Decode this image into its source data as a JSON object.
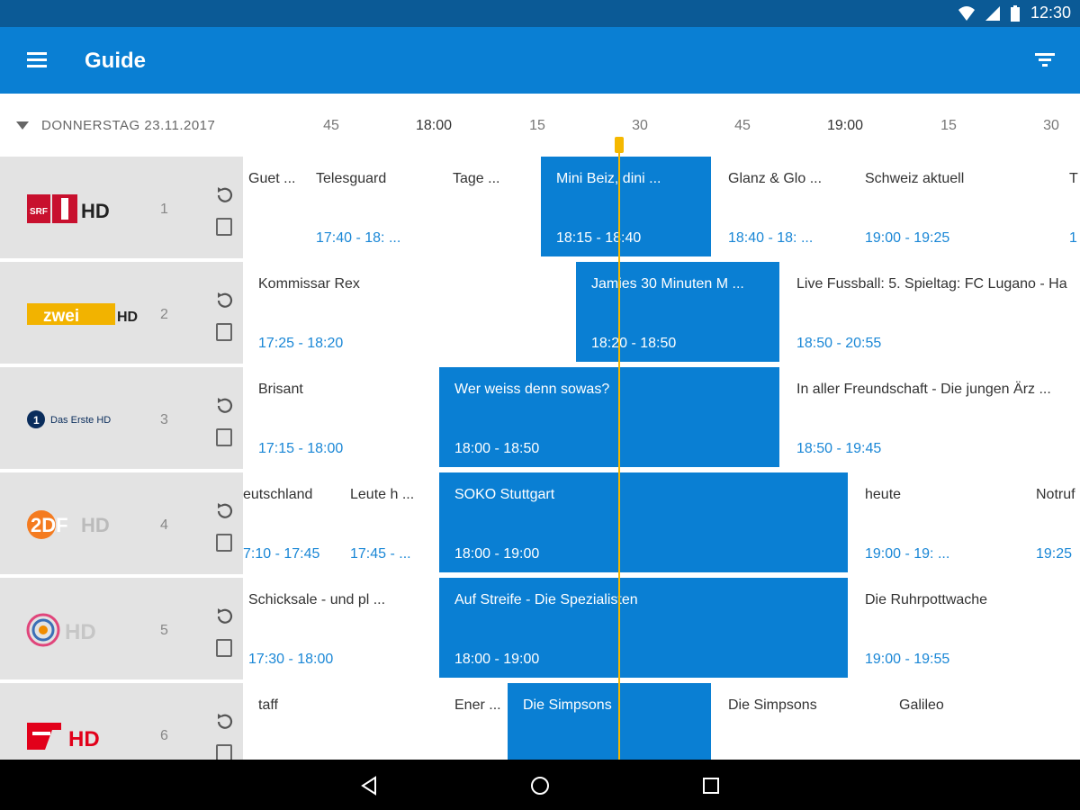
{
  "status": {
    "time": "12:30"
  },
  "appbar": {
    "title": "Guide"
  },
  "timebar": {
    "date": "DONNERSTAG 23.11.2017",
    "ticks": [
      "45",
      "18:00",
      "15",
      "30",
      "45",
      "19:00",
      "15",
      "30"
    ]
  },
  "colors": {
    "accent": "#0a7fd3",
    "now_line": "#f5b800",
    "time_text": "#1a87d6"
  },
  "channels": [
    {
      "number": "1",
      "logo": "SRF 1 HD",
      "programs": [
        {
          "title": "Guet ...",
          "time": ""
        },
        {
          "title": "Telesguard",
          "time": "17:40 - 18: ..."
        },
        {
          "title": "Tage ...",
          "time": ""
        },
        {
          "title": "Mini Beiz, dini ...",
          "time": "18:15 - 18:40"
        },
        {
          "title": "Glanz & Glo ...",
          "time": "18:40 - 18: ..."
        },
        {
          "title": "Schweiz aktuell",
          "time": "19:00 - 19:25"
        },
        {
          "title": "T",
          "time": "1"
        }
      ]
    },
    {
      "number": "2",
      "logo": "SRF zwei HD",
      "programs": [
        {
          "title": "Kommissar Rex",
          "time": "17:25 - 18:20"
        },
        {
          "title": "Jamies 30 Minuten M ...",
          "time": "18:20 - 18:50"
        },
        {
          "title": "Live Fussball: 5. Spieltag: FC Lugano - Ha",
          "time": "18:50 - 20:55"
        }
      ]
    },
    {
      "number": "3",
      "logo": "Das Erste HD",
      "programs": [
        {
          "title": "Brisant",
          "time": "17:15 - 18:00"
        },
        {
          "title": "Wer weiss denn sowas?",
          "time": "18:00 - 18:50"
        },
        {
          "title": "In aller Freundschaft - Die jungen Ärz ...",
          "time": "18:50 - 19:45"
        }
      ]
    },
    {
      "number": "4",
      "logo": "ZDF HD",
      "programs": [
        {
          "title": "eutschland",
          "time": "7:10 - 17:45"
        },
        {
          "title": "Leute h ...",
          "time": "17:45 - ..."
        },
        {
          "title": "SOKO Stuttgart",
          "time": "18:00 - 19:00"
        },
        {
          "title": "heute",
          "time": "19:00 - 19: ..."
        },
        {
          "title": "Notruf",
          "time": "19:25"
        }
      ]
    },
    {
      "number": "5",
      "logo": "Sat.1 HD",
      "programs": [
        {
          "title": "Schicksale - und pl ...",
          "time": "17:30 - 18:00"
        },
        {
          "title": "Auf Streife - Die Spezialisten",
          "time": "18:00 - 19:00"
        },
        {
          "title": "Die Ruhrpottwache",
          "time": "19:00 - 19:55"
        }
      ]
    },
    {
      "number": "6",
      "logo": "ProSieben HD",
      "programs": [
        {
          "title": "taff",
          "time": ""
        },
        {
          "title": "Ener ...",
          "time": ""
        },
        {
          "title": "Die Simpsons",
          "time": ""
        },
        {
          "title": "Die Simpsons",
          "time": ""
        },
        {
          "title": "Galileo",
          "time": ""
        }
      ]
    }
  ]
}
